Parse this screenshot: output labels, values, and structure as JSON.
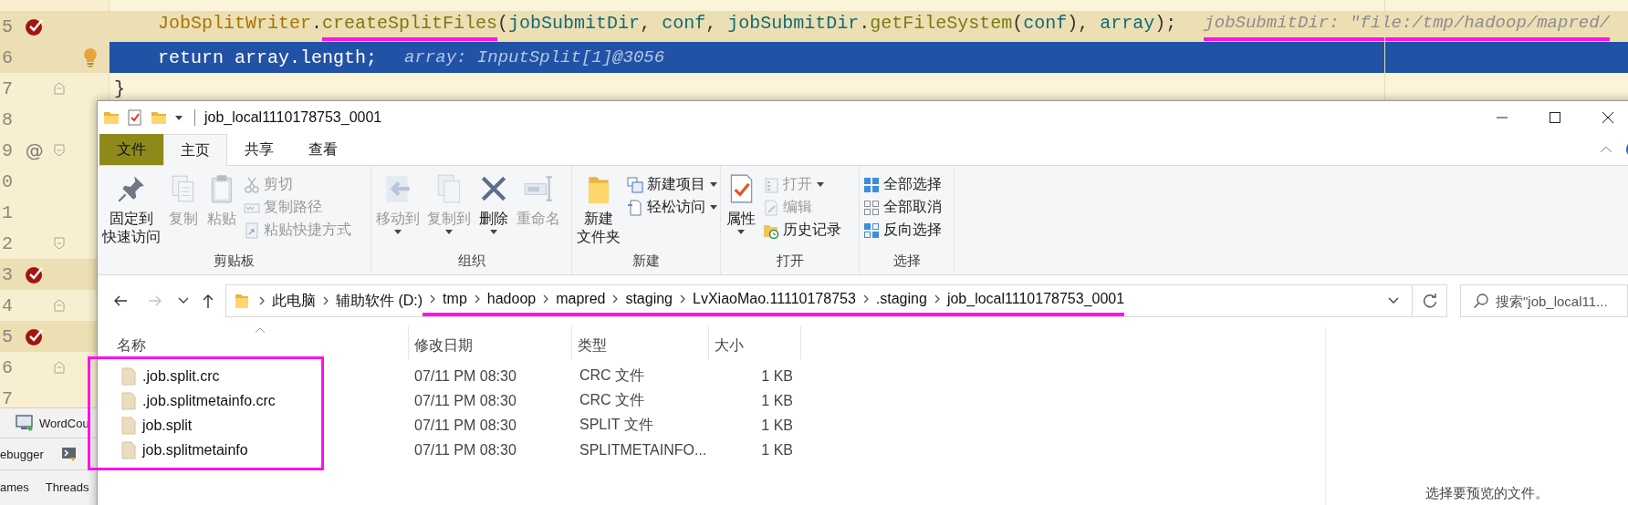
{
  "editor": {
    "gutter": [
      {
        "number": "5",
        "breakpoint": true,
        "bulb": false,
        "fold_start": false,
        "fold_end": false,
        "highlighted": true
      },
      {
        "number": "6",
        "breakpoint": false,
        "bulb": true,
        "fold_start": false,
        "fold_end": false,
        "highlighted": true
      },
      {
        "number": "7",
        "breakpoint": false,
        "bulb": false,
        "fold_start": false,
        "fold_end": true,
        "highlighted": false
      },
      {
        "number": "8",
        "breakpoint": false,
        "bulb": false,
        "fold_start": false,
        "fold_end": false,
        "highlighted": false
      },
      {
        "number": "9",
        "symbol": "@",
        "breakpoint": false,
        "bulb": false,
        "fold_start": true,
        "fold_end": false,
        "highlighted": false
      },
      {
        "number": "0",
        "breakpoint": false,
        "bulb": false,
        "fold_start": false,
        "fold_end": false,
        "highlighted": false
      },
      {
        "number": "1",
        "breakpoint": false,
        "bulb": false,
        "fold_start": false,
        "fold_end": false,
        "highlighted": false
      },
      {
        "number": "2",
        "breakpoint": false,
        "bulb": false,
        "fold_start": true,
        "fold_end": false,
        "highlighted": false
      },
      {
        "number": "3",
        "breakpoint": true,
        "bulb": false,
        "fold_start": false,
        "fold_end": false,
        "highlighted": true
      },
      {
        "number": "4",
        "breakpoint": false,
        "bulb": false,
        "fold_start": false,
        "fold_end": true,
        "highlighted": false
      },
      {
        "number": "5",
        "breakpoint": true,
        "bulb": false,
        "fold_start": false,
        "fold_end": false,
        "highlighted": true
      },
      {
        "number": "6",
        "breakpoint": false,
        "bulb": false,
        "fold_start": false,
        "fold_end": true,
        "highlighted": false
      },
      {
        "number": "7",
        "breakpoint": false,
        "bulb": false,
        "fold_start": false,
        "fold_end": false,
        "highlighted": false
      }
    ],
    "method_body": [
      {
        "kind": "breakpoint",
        "tokens": [
          {
            "text": "JobSplitWriter",
            "kind": "class",
            "underlined": false
          },
          {
            "text": ".",
            "kind": "punct",
            "underlined": false
          },
          {
            "text": "createSplitFiles",
            "kind": "method",
            "underlined": true
          },
          {
            "text": "(",
            "kind": "punct",
            "underlined": false
          },
          {
            "text": "jobSubmitDir",
            "kind": "param",
            "underlined": false
          },
          {
            "text": ", ",
            "kind": "punct",
            "underlined": false
          },
          {
            "text": "conf",
            "kind": "param",
            "underlined": false
          },
          {
            "text": ", ",
            "kind": "punct",
            "underlined": false
          },
          {
            "text": "jobSubmitDir",
            "kind": "param",
            "underlined": false
          },
          {
            "text": ".",
            "kind": "punct",
            "underlined": false
          },
          {
            "text": "getFileSystem",
            "kind": "method",
            "underlined": false
          },
          {
            "text": "(",
            "kind": "punct",
            "underlined": false
          },
          {
            "text": "conf",
            "kind": "param",
            "underlined": false
          },
          {
            "text": "), ",
            "kind": "punct",
            "underlined": false
          },
          {
            "text": "array",
            "kind": "param",
            "underlined": false
          },
          {
            "text": ");",
            "kind": "punct",
            "underlined": false
          }
        ],
        "hint": {
          "text": "jobSubmitDir: \"file:/tmp/hadoop/mapred/",
          "underlined": true
        }
      },
      {
        "kind": "execution",
        "tokens": [
          {
            "text": "return",
            "kind": "keyword",
            "underlined": false
          },
          {
            "text": " array.length;",
            "kind": "punct",
            "underlined": false
          }
        ],
        "hint": {
          "text": "array: InputSplit[1]@3056",
          "underlined": false
        }
      }
    ],
    "closing": "}"
  },
  "debug_panel": {
    "session": "WordCou",
    "tool_tab": "ebugger",
    "subtabs": [
      "ames",
      "Threads"
    ]
  },
  "explorer": {
    "title": "job_local1110178753_0001",
    "tabs": [
      {
        "label": "文件",
        "kind": "file",
        "selected": false
      },
      {
        "label": "主页",
        "kind": "tab",
        "selected": true
      },
      {
        "label": "共享",
        "kind": "tab",
        "selected": false
      },
      {
        "label": "查看",
        "kind": "tab",
        "selected": false
      }
    ],
    "groups": [
      {
        "label": "剪贴板",
        "items": [
          {
            "lines": [
              "固定到",
              "快速访问"
            ],
            "kind": "large",
            "disabled": false,
            "dropdown": false
          },
          {
            "lines": [
              "复制"
            ],
            "kind": "large",
            "disabled": true,
            "dropdown": false
          },
          {
            "lines": [
              "粘贴"
            ],
            "kind": "large",
            "disabled": true,
            "dropdown": false
          },
          {
            "lines": [
              "剪切"
            ],
            "kind": "small",
            "disabled": true,
            "dropdown": false
          },
          {
            "lines": [
              "复制路径"
            ],
            "kind": "small",
            "disabled": true,
            "dropdown": false
          },
          {
            "lines": [
              "粘贴快捷方式"
            ],
            "kind": "small",
            "disabled": true,
            "dropdown": false
          }
        ]
      },
      {
        "label": "组织",
        "items": [
          {
            "lines": [
              "移动到"
            ],
            "kind": "large",
            "disabled": true,
            "dropdown": true
          },
          {
            "lines": [
              "复制到"
            ],
            "kind": "large",
            "disabled": true,
            "dropdown": true
          },
          {
            "lines": [
              "删除"
            ],
            "kind": "large",
            "disabled": false,
            "dropdown": true
          },
          {
            "lines": [
              "重命名"
            ],
            "kind": "large",
            "disabled": true,
            "dropdown": false
          }
        ]
      },
      {
        "label": "新建",
        "items": [
          {
            "lines": [
              "新建",
              "文件夹"
            ],
            "kind": "large",
            "disabled": false,
            "dropdown": false
          },
          {
            "lines": [
              "新建项目"
            ],
            "kind": "small",
            "disabled": false,
            "dropdown": true
          },
          {
            "lines": [
              "轻松访问"
            ],
            "kind": "small",
            "disabled": false,
            "dropdown": true
          }
        ]
      },
      {
        "label": "打开",
        "items": [
          {
            "lines": [
              "属性"
            ],
            "kind": "large",
            "disabled": false,
            "dropdown": true
          },
          {
            "lines": [
              "打开"
            ],
            "kind": "small",
            "disabled": true,
            "dropdown": true
          },
          {
            "lines": [
              "编辑"
            ],
            "kind": "small",
            "disabled": true,
            "dropdown": false
          },
          {
            "lines": [
              "历史记录"
            ],
            "kind": "small",
            "disabled": false,
            "dropdown": false
          }
        ]
      },
      {
        "label": "选择",
        "items": [
          {
            "lines": [
              "全部选择"
            ],
            "kind": "small",
            "disabled": false,
            "dropdown": false
          },
          {
            "lines": [
              "全部取消"
            ],
            "kind": "small",
            "disabled": false,
            "dropdown": false
          },
          {
            "lines": [
              "反向选择"
            ],
            "kind": "small",
            "disabled": false,
            "dropdown": false
          }
        ]
      }
    ],
    "address": {
      "segments": [
        {
          "label": "此电脑",
          "underlined": false
        },
        {
          "label": "辅助软件 (D:)",
          "underlined": false
        },
        {
          "label": "tmp",
          "underlined": true
        },
        {
          "label": "hadoop",
          "underlined": true
        },
        {
          "label": "mapred",
          "underlined": true
        },
        {
          "label": "staging",
          "underlined": true
        },
        {
          "label": "LvXiaoMao.11110178753",
          "underlined": true
        },
        {
          "label": ".staging",
          "underlined": true
        },
        {
          "label": "job_local1110178753_0001",
          "underlined": true
        }
      ],
      "search_placeholder": "搜索\"job_local11..."
    },
    "file_list": {
      "framed": true,
      "columns": [
        {
          "label": "名称",
          "sorted": true
        },
        {
          "label": "修改日期",
          "sorted": false
        },
        {
          "label": "类型",
          "sorted": false
        },
        {
          "label": "大小",
          "sorted": false
        }
      ],
      "rows": [
        {
          "name": ".job.split.crc",
          "date": "07/11 PM 08:30",
          "type": "CRC 文件",
          "size": "1 KB"
        },
        {
          "name": ".job.splitmetainfo.crc",
          "date": "07/11 PM 08:30",
          "type": "CRC 文件",
          "size": "1 KB"
        },
        {
          "name": "job.split",
          "date": "07/11 PM 08:30",
          "type": "SPLIT 文件",
          "size": "1 KB"
        },
        {
          "name": "job.splitmetainfo",
          "date": "07/11 PM 08:30",
          "type": "SPLITMETAINFO...",
          "size": "1 KB"
        }
      ]
    },
    "preview_text": "选择要预览的文件。"
  }
}
